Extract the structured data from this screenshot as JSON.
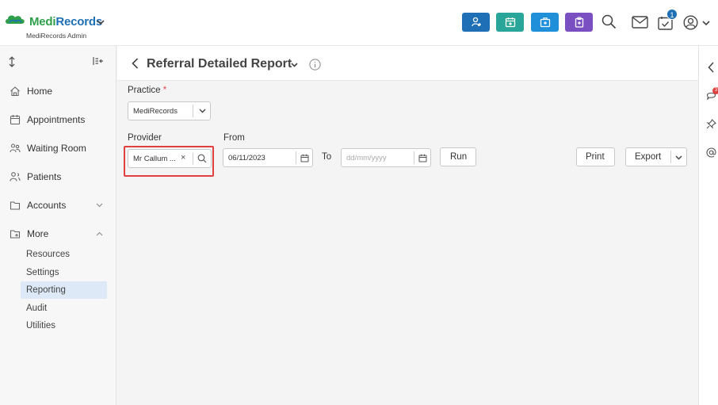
{
  "brand": {
    "name_part1": "Medi",
    "name_part2": "Records",
    "subtitle": "MediRecords Admin"
  },
  "topbar": {
    "buttons": [
      {
        "name": "add-patient",
        "color": "#1e6fb5"
      },
      {
        "name": "appointment-book",
        "color": "#2aa59a"
      },
      {
        "name": "medical-kit",
        "color": "#1e8fd8"
      },
      {
        "name": "clipboard",
        "color": "#7a4fc2"
      }
    ],
    "task_badge": "1"
  },
  "sidebar": {
    "items": [
      {
        "label": "Home",
        "icon": "home-icon"
      },
      {
        "label": "Appointments",
        "icon": "calendar-icon"
      },
      {
        "label": "Waiting Room",
        "icon": "waiting-room-icon"
      },
      {
        "label": "Patients",
        "icon": "patients-icon"
      },
      {
        "label": "Accounts",
        "icon": "folder-icon"
      },
      {
        "label": "More",
        "icon": "folder-plus-icon"
      }
    ],
    "sub_items": [
      {
        "label": "Resources",
        "active": false
      },
      {
        "label": "Settings",
        "active": false
      },
      {
        "label": "Reporting",
        "active": true
      },
      {
        "label": "Audit",
        "active": false
      },
      {
        "label": "Utilities",
        "active": false
      }
    ]
  },
  "page": {
    "title": "Referral Detailed Report",
    "practice_label": "Practice",
    "practice_required": "*",
    "practice_value": "MediRecords",
    "provider_label": "Provider",
    "provider_value": "Mr Callum ...",
    "provider_clear": "×",
    "from_label": "From",
    "from_value": "06/11/2023",
    "to_label": "To",
    "to_placeholder": "dd/mm/yyyy",
    "run_label": "Run",
    "print_label": "Print",
    "export_label": "Export"
  },
  "rail": {
    "mentions_badge": "3"
  },
  "colors": {
    "accent": "#1e6fb5",
    "active_bg": "#dde9f6",
    "highlight": "#e04040"
  }
}
